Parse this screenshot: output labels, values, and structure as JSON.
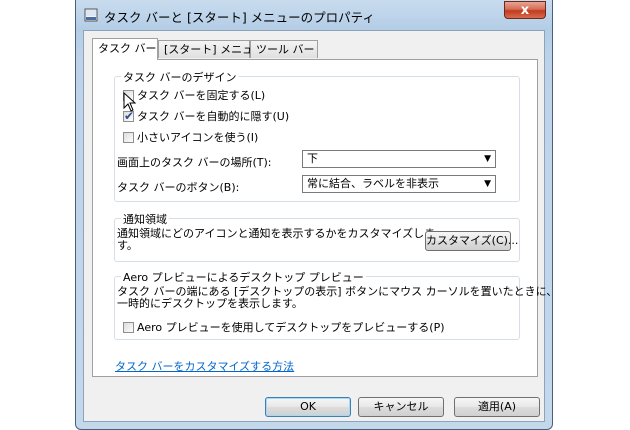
{
  "window": {
    "title": "タスク バーと [スタート] メニューのプロパティ",
    "close_label": "x"
  },
  "tabs": [
    {
      "label": "タスク バー"
    },
    {
      "label": "[スタート] メニュー"
    },
    {
      "label": "ツール バー"
    }
  ],
  "design_group": {
    "title": "タスク バーのデザイン",
    "lock_label": "タスク バーを固定する(L)",
    "lock_checked": false,
    "autohide_label": "タスク バーを自動的に隠す(U)",
    "autohide_checked": true,
    "small_icons_label": "小さいアイコンを使う(I)",
    "small_icons_checked": false,
    "location_label": "画面上のタスク バーの場所(T):",
    "location_value": "下",
    "buttons_label": "タスク バーのボタン(B):",
    "buttons_value": "常に結合、ラベルを非表示"
  },
  "notify_group": {
    "title": "通知領域",
    "description_line1": "通知領域にどのアイコンと通知を表示するかをカスタマイズしま",
    "description_line2": "す。",
    "customize_button": "カスタマイズ(C)..."
  },
  "aero_group": {
    "title": "Aero プレビューによるデスクトップ プレビュー",
    "description_line1": "タスク バーの端にある [デスクトップの表示] ボタンにマウス カーソルを置いたときに、",
    "description_line2": "一時的にデスクトップを表示します。",
    "peek_label": "Aero プレビューを使用してデスクトップをプレビューする(P)",
    "peek_checked": false
  },
  "help_link": "タスク バーをカスタマイズする方法",
  "footer": {
    "ok": "OK",
    "cancel": "キャンセル",
    "apply": "適用(A)"
  },
  "icons": {
    "check_glyph": "✔",
    "dropdown_glyph": "▼"
  }
}
